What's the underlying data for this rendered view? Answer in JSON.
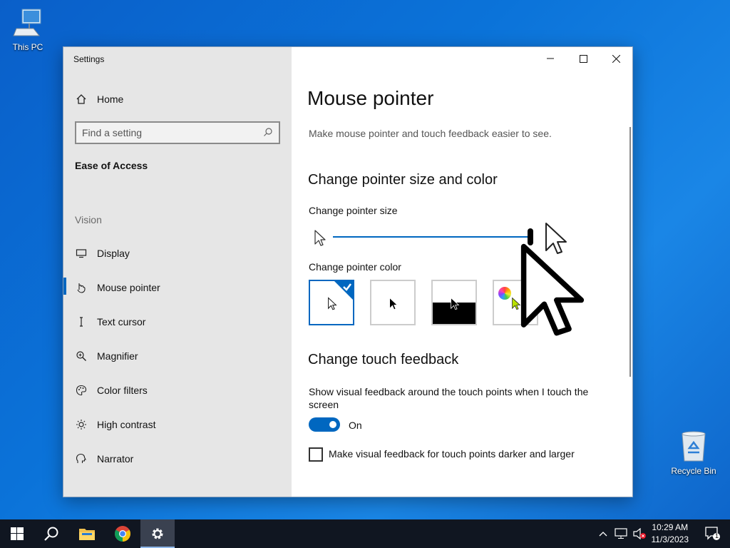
{
  "desktop": {
    "this_pc_label": "This PC",
    "recycle_bin_label": "Recycle Bin"
  },
  "window": {
    "title": "Settings"
  },
  "sidebar": {
    "home_label": "Home",
    "search_placeholder": "Find a setting",
    "section_title": "Ease of Access",
    "group_label": "Vision",
    "items": [
      {
        "label": "Display",
        "icon": "display-icon"
      },
      {
        "label": "Mouse pointer",
        "icon": "mouse-pointer-icon",
        "selected": true
      },
      {
        "label": "Text cursor",
        "icon": "text-cursor-icon"
      },
      {
        "label": "Magnifier",
        "icon": "magnifier-icon"
      },
      {
        "label": "Color filters",
        "icon": "color-filters-icon"
      },
      {
        "label": "High contrast",
        "icon": "high-contrast-icon"
      },
      {
        "label": "Narrator",
        "icon": "narrator-icon"
      }
    ]
  },
  "main": {
    "title": "Mouse pointer",
    "subtitle": "Make mouse pointer and touch feedback easier to see.",
    "size_color_heading": "Change pointer size and color",
    "size_label": "Change pointer size",
    "size_value_fraction": 1.0,
    "color_label": "Change pointer color",
    "color_options": [
      "white",
      "black",
      "inverted",
      "custom"
    ],
    "selected_color": "white",
    "touch_heading": "Change touch feedback",
    "touch_desc": "Show visual feedback around the touch points when I touch the screen",
    "toggle_state": "On",
    "darker_label": "Make visual feedback for touch points darker and larger",
    "darker_checked": false
  },
  "taskbar": {
    "time": "10:29 AM",
    "date": "11/3/2023",
    "notification_count": "1"
  },
  "colors": {
    "accent": "#0067c0",
    "sidebar_bg": "#e6e6e6",
    "taskbar_bg": "#101621"
  }
}
